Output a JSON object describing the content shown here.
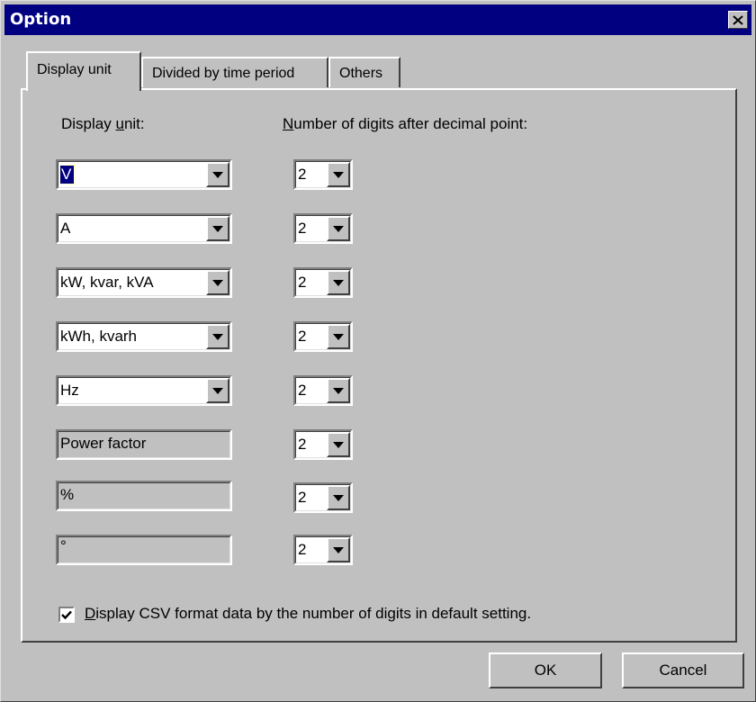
{
  "window": {
    "title": "Option"
  },
  "tabs": [
    {
      "label": "Display unit",
      "active": true
    },
    {
      "label": "Divided by time period",
      "active": false
    },
    {
      "label": "Others",
      "active": false
    }
  ],
  "labels": {
    "display_unit_prefix": "Display ",
    "display_unit_accel": "u",
    "display_unit_suffix": "nit:",
    "digits_accel": "N",
    "digits_suffix": "umber of digits after decimal point:"
  },
  "rows": [
    {
      "unit": "V",
      "editable": true,
      "digits": "2"
    },
    {
      "unit": "A",
      "editable": true,
      "digits": "2"
    },
    {
      "unit": "kW, kvar, kVA",
      "editable": true,
      "digits": "2"
    },
    {
      "unit": "kWh, kvarh",
      "editable": true,
      "digits": "2"
    },
    {
      "unit": "Hz",
      "editable": true,
      "digits": "2"
    },
    {
      "unit": "Power factor",
      "editable": false,
      "digits": "2"
    },
    {
      "unit": "%",
      "editable": false,
      "digits": "2"
    },
    {
      "unit": "°",
      "editable": false,
      "digits": "2"
    }
  ],
  "checkbox": {
    "checked": true,
    "label_accel": "D",
    "label_rest": "isplay CSV format data by the number of digits in default setting."
  },
  "buttons": {
    "ok": "OK",
    "cancel": "Cancel"
  },
  "icons": {
    "close": "close-icon",
    "check": "checkmark-icon",
    "dropdown": "dropdown-arrow-icon"
  }
}
